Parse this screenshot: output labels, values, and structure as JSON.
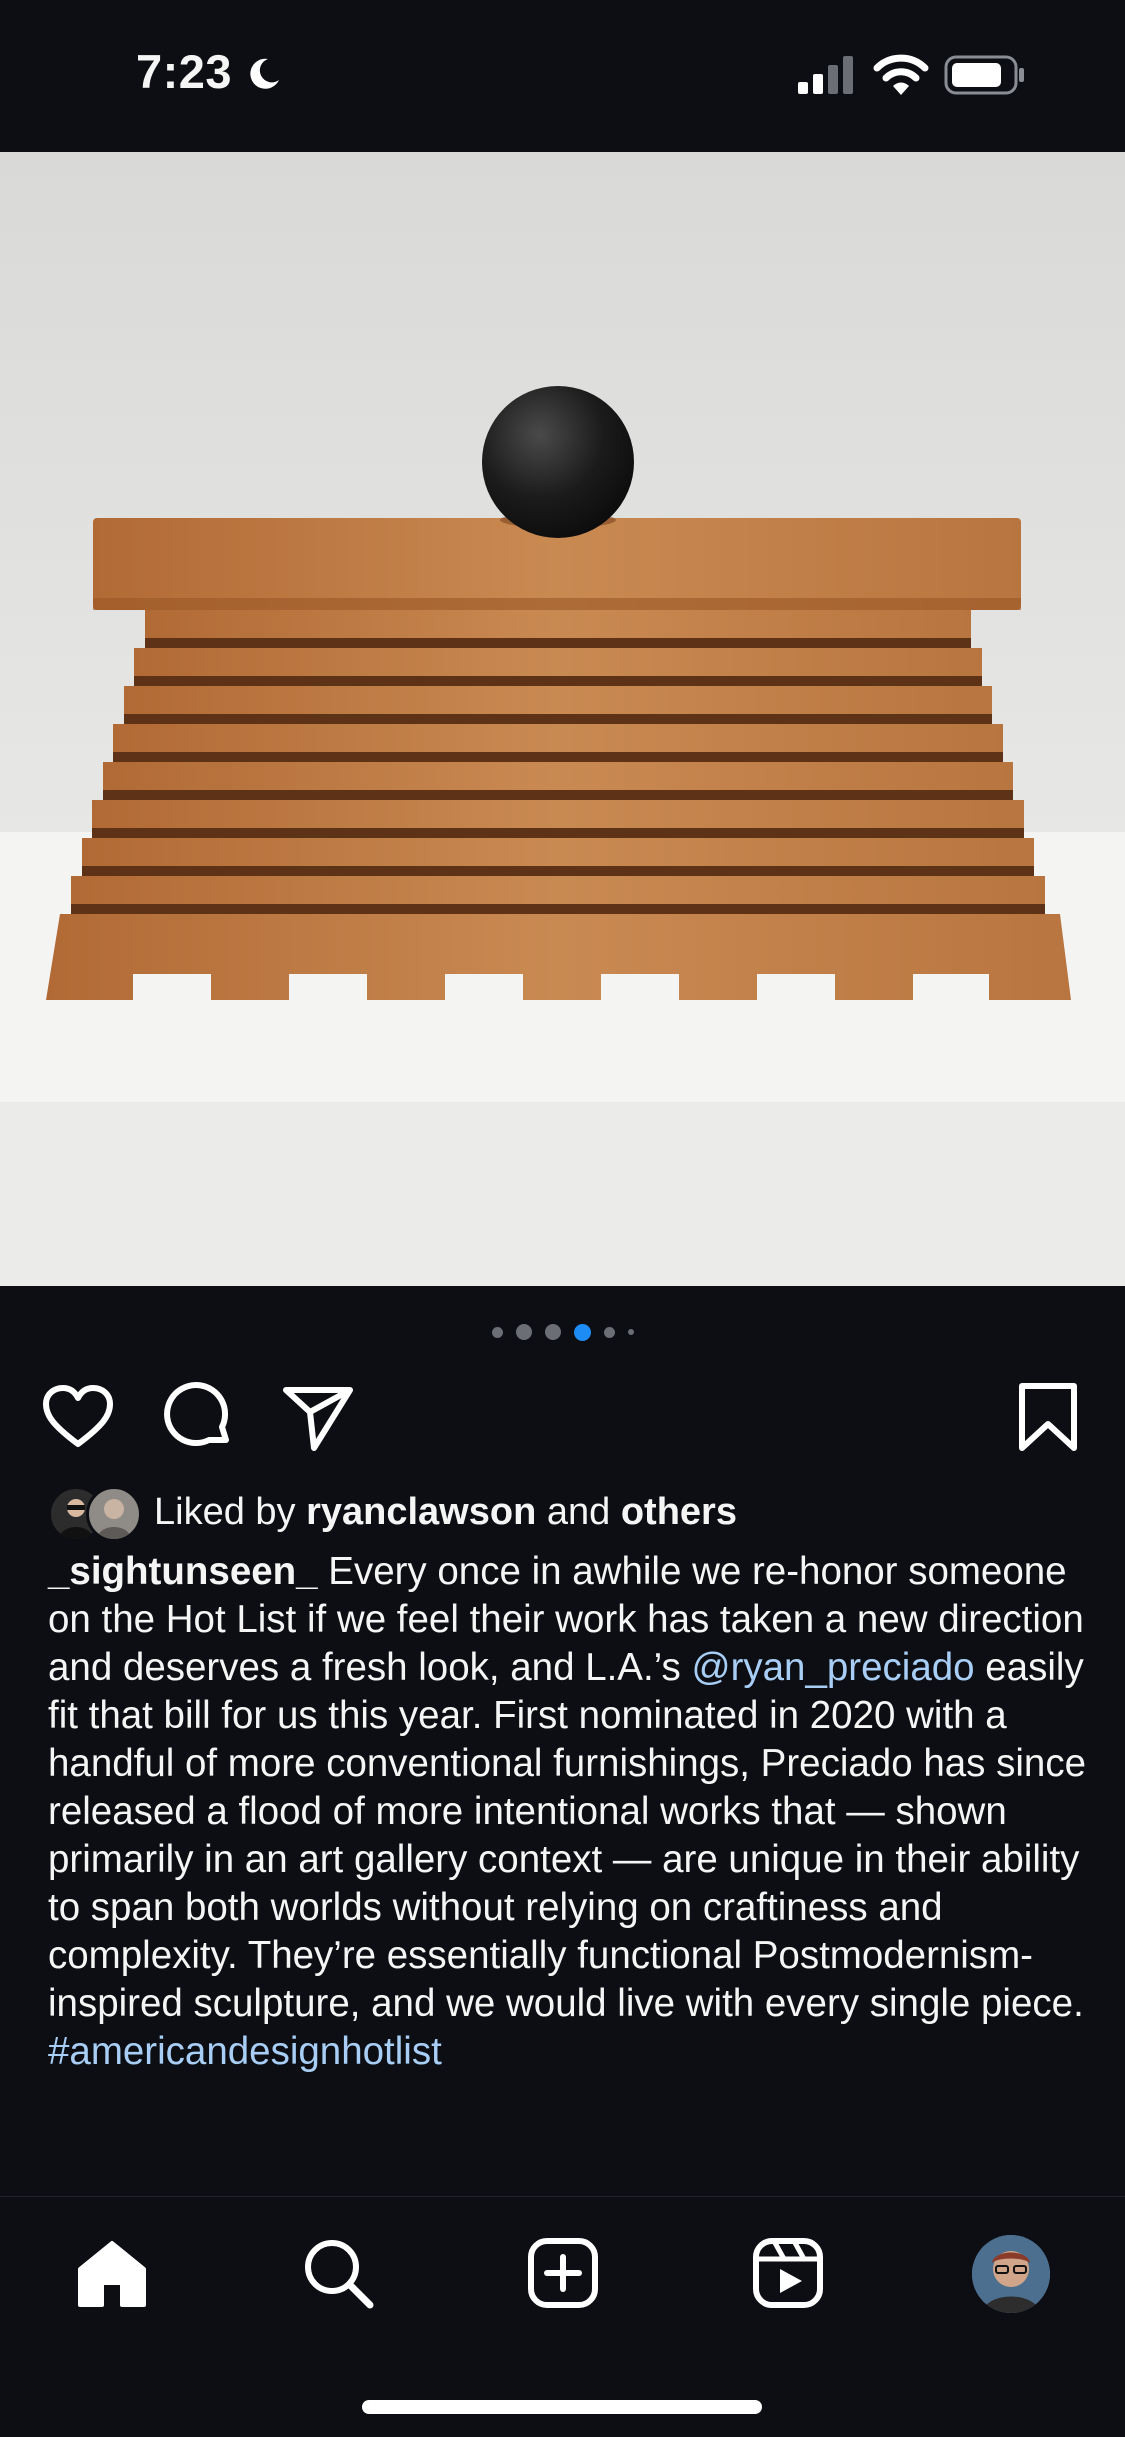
{
  "status_bar": {
    "time": "7:23",
    "moon_icon": "moon-icon",
    "signal_icon": "cellular-signal-icon",
    "wifi_icon": "wifi-icon",
    "battery_icon": "battery-icon"
  },
  "post": {
    "image_alt": "Wooden slatted box sculpture with black sphere on top",
    "carousel": {
      "count": 6,
      "active_index": 3
    },
    "actions": {
      "like_icon": "heart-icon",
      "comment_icon": "comment-icon",
      "share_icon": "send-icon",
      "save_icon": "bookmark-icon"
    },
    "likes": {
      "prefix": "Liked by ",
      "user": "ryanclawson",
      "middle": " and ",
      "others": "others"
    },
    "caption": {
      "username": "_sightunseen_",
      "text_before_mention": " Every once in awhile we re-honor someone on the Hot List if we feel their work has taken a new direction and deserves a fresh look, and L.A.’s ",
      "mention": "@ryan_preciado",
      "text_after_mention": " easily fit that bill for us this year. First nominated in 2020 with a handful of more conventional furnishings, Preciado has since released a flood of more intentional works that — shown primarily in an art gallery context — are unique in their ability to span both worlds without relying on craftiness and complexity. They’re essentially functional Postmodernism-inspired sculpture, and we would live with every single piece.",
      "hashtag": "#americandesignhotlist"
    }
  },
  "bottom_nav": {
    "items": [
      "home-icon",
      "search-icon",
      "create-icon",
      "reels-icon",
      "profile-avatar"
    ]
  },
  "colors": {
    "background": "#0c0e13",
    "link": "#a8cef5",
    "active_dot": "#1d8df5"
  }
}
